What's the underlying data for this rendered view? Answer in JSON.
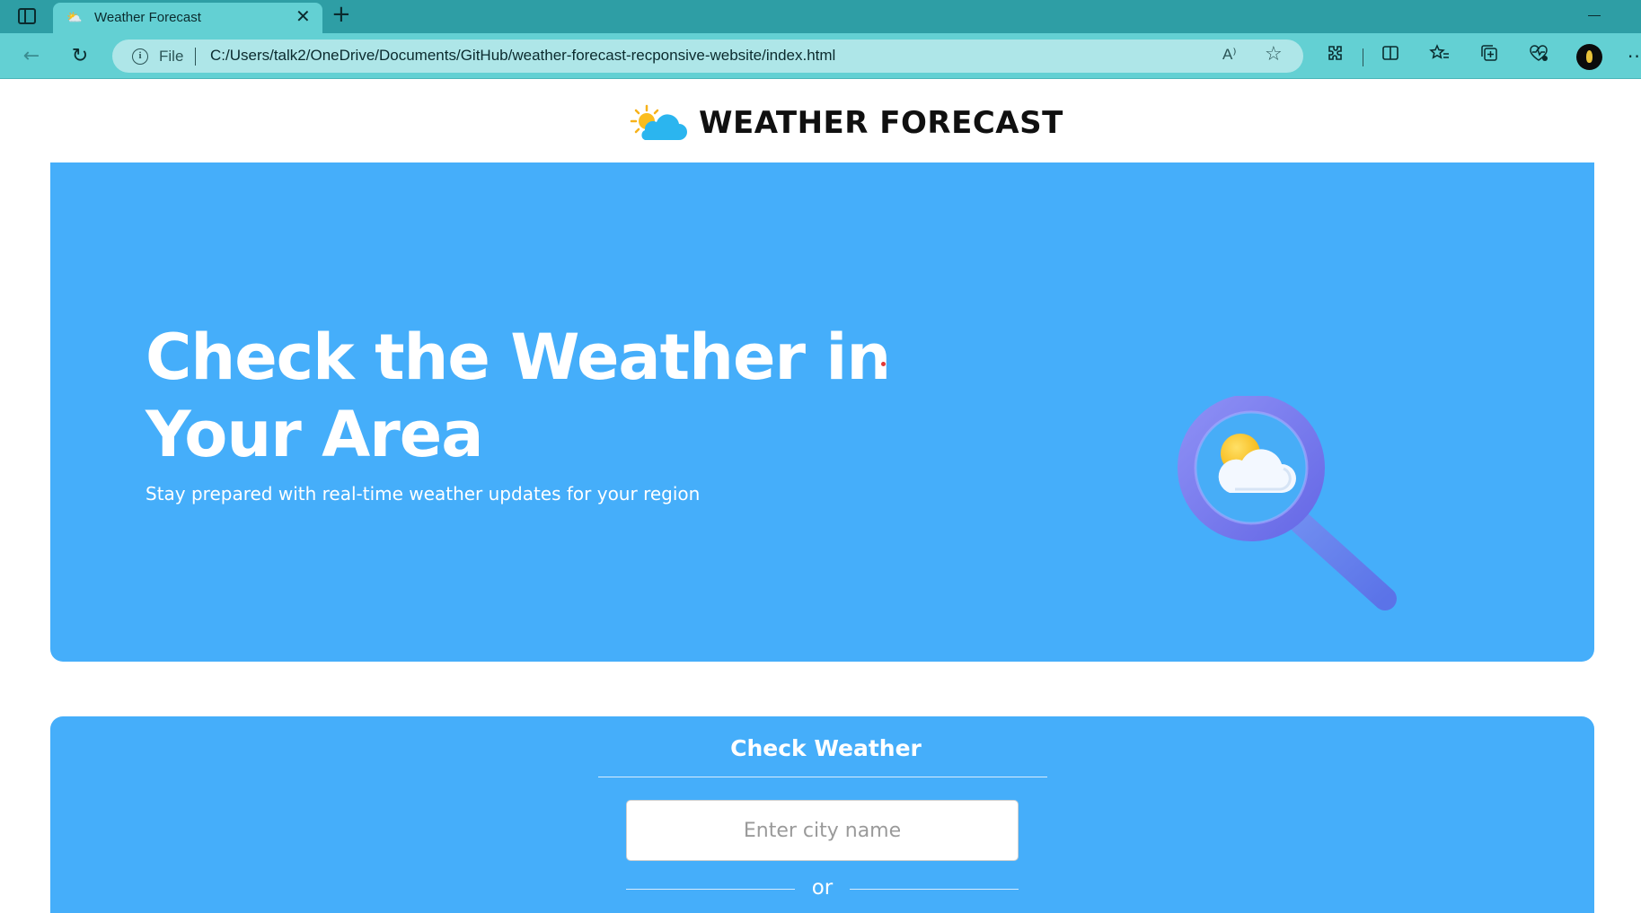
{
  "browser": {
    "tab_title": "Weather Forecast",
    "file_label": "File",
    "url": "C:/Users/talk2/OneDrive/Documents/GitHub/weather-forecast-recponsive-website/index.html",
    "read_aloud_label": "A⁾"
  },
  "header": {
    "brand_name": "WEATHER FORECAST"
  },
  "hero": {
    "title": "Check the Weather in Your Area",
    "subtitle": "Stay prepared with real-time weather updates for your region"
  },
  "check_weather": {
    "title": "Check Weather",
    "city_placeholder": "Enter city name",
    "divider_text": "or"
  },
  "colors": {
    "hero_bg": "#45aefa",
    "browser_tabbar": "#2e9ea5",
    "browser_toolbar": "#63d0d3"
  }
}
